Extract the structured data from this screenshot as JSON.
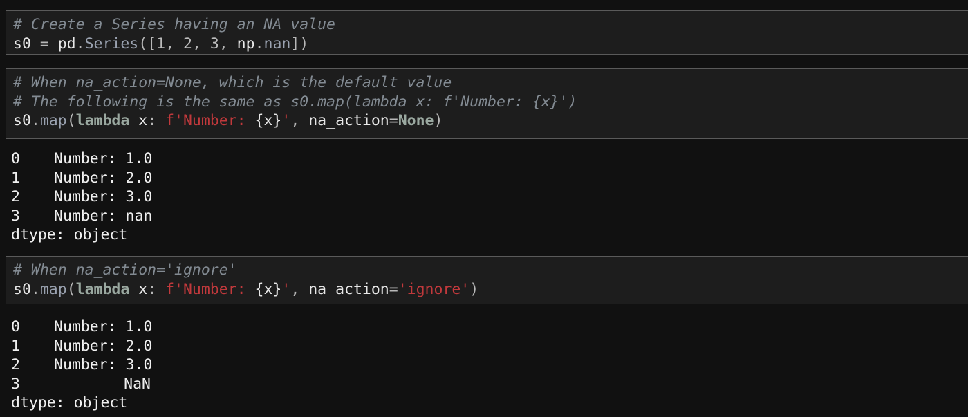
{
  "cells": [
    {
      "comment_lines": [
        "# Create a Series having an NA value"
      ],
      "code": {
        "var": "s0",
        "eq": " = ",
        "obj": "pd",
        "dot": ".",
        "func": "Series",
        "open": "([",
        "n1": "1",
        "sep1": ", ",
        "n2": "2",
        "sep2": ", ",
        "n3": "3",
        "sep3": ", ",
        "np": "np",
        "dot2": ".",
        "nan": "nan",
        "close": "])"
      }
    },
    {
      "comment_lines": [
        "# When na_action=None, which is the default value",
        "# The following is the same as s0.map(lambda x: f'Number: {x}')"
      ],
      "code": {
        "obj": "s0",
        "dot": ".",
        "method": "map",
        "open": "(",
        "lambda": "lambda",
        "arg": " x",
        "colon": ": ",
        "fstr_start": "f'Number: ",
        "interp": "{x}",
        "fstr_end": "'",
        "comma": ", ",
        "kwarg": "na_action",
        "eq": "=",
        "kwval": "None",
        "close": ")"
      }
    },
    {
      "comment_lines": [
        "# When na_action='ignore'"
      ],
      "code": {
        "obj": "s0",
        "dot": ".",
        "method": "map",
        "open": "(",
        "lambda": "lambda",
        "arg": " x",
        "colon": ": ",
        "fstr_start": "f'Number: ",
        "interp": "{x}",
        "fstr_end": "'",
        "comma": ", ",
        "kwarg": "na_action",
        "eq": "=",
        "kwval": "'ignore'",
        "close": ")"
      }
    }
  ],
  "outputs": [
    {
      "rows": [
        {
          "index": "0",
          "value": "Number: 1.0"
        },
        {
          "index": "1",
          "value": "Number: 2.0"
        },
        {
          "index": "2",
          "value": "Number: 3.0"
        },
        {
          "index": "3",
          "value": "Number: nan"
        }
      ],
      "dtype": "dtype: object"
    },
    {
      "rows": [
        {
          "index": "0",
          "value": "Number: 1.0"
        },
        {
          "index": "1",
          "value": "Number: 2.0"
        },
        {
          "index": "2",
          "value": "Number: 3.0"
        },
        {
          "index": "3",
          "value": "NaN"
        }
      ],
      "dtype": "dtype: object"
    }
  ],
  "colors": {
    "background": "#111111",
    "cell_background": "#1d1d1d",
    "cell_border": "#5a5a5a",
    "comment": "#838b93",
    "string": "#c1393c",
    "keyword": "#9aa8a0",
    "text": "#e6e6e6"
  }
}
